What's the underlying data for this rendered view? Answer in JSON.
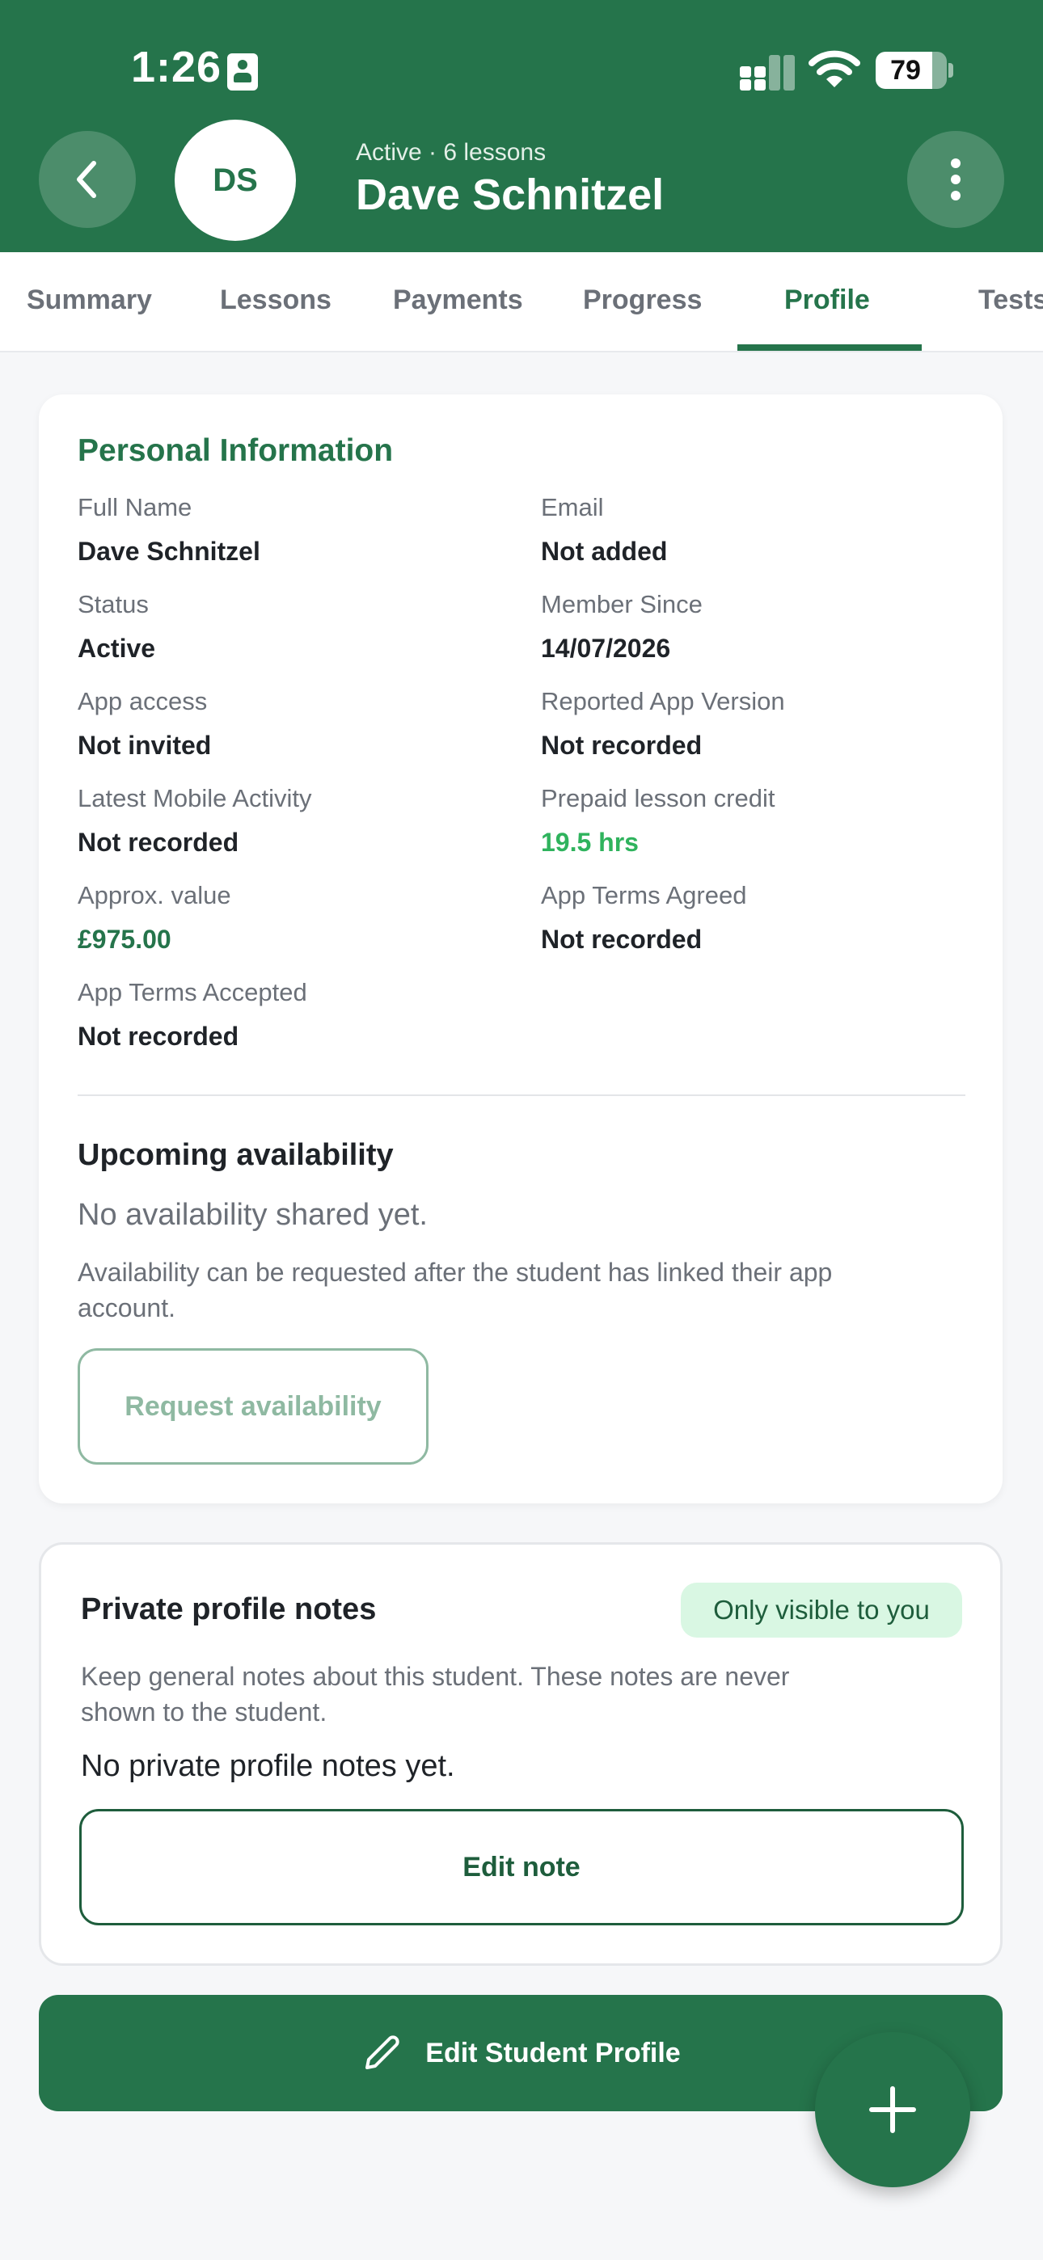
{
  "status_bar": {
    "time": "1:26",
    "battery": "79",
    "battery_level": 0.79
  },
  "header": {
    "avatar_initials": "DS",
    "subtitle": "Active · 6 lessons",
    "title": "Dave Schnitzel"
  },
  "tabs": [
    {
      "label": "Summary"
    },
    {
      "label": "Lessons"
    },
    {
      "label": "Payments"
    },
    {
      "label": "Progress"
    },
    {
      "label": "Profile",
      "active": true
    },
    {
      "label": "Tests"
    }
  ],
  "personal_info": {
    "title": "Personal Information",
    "fields": [
      {
        "label": "Full Name",
        "value": "Dave Schnitzel"
      },
      {
        "label": "Email",
        "value": "Not added"
      },
      {
        "label": "Status",
        "value": "Active"
      },
      {
        "label": "Member Since",
        "value": "14/07/2026"
      },
      {
        "label": "App access",
        "value": "Not invited"
      },
      {
        "label": "Reported App Version",
        "value": "Not recorded"
      },
      {
        "label": "Latest Mobile Activity",
        "value": "Not recorded"
      },
      {
        "label": "Prepaid lesson credit",
        "value": "19.5 hrs"
      },
      {
        "label": "Approx. value",
        "value": "£975.00"
      },
      {
        "label": "App Terms Agreed",
        "value": "Not recorded"
      },
      {
        "label": "App Terms Accepted",
        "value": "Not recorded"
      }
    ]
  },
  "availability": {
    "title": "Upcoming availability",
    "empty": "No availability shared yet.",
    "hint_line1": "Availability can be requested after the student has linked their app",
    "hint_line2": "account.",
    "button": "Request availability"
  },
  "notes": {
    "title": "Private profile notes",
    "badge": "Only visible to you",
    "desc_line1": "Keep general notes about this student. These notes are never",
    "desc_line2": "shown to the student.",
    "empty": "No private profile notes yet.",
    "button": "Edit note"
  },
  "edit_profile_button": "Edit Student Profile",
  "colors": {
    "brand": "#25744b",
    "credit": "#2fb35d",
    "badge_bg": "#d9f7e3"
  }
}
